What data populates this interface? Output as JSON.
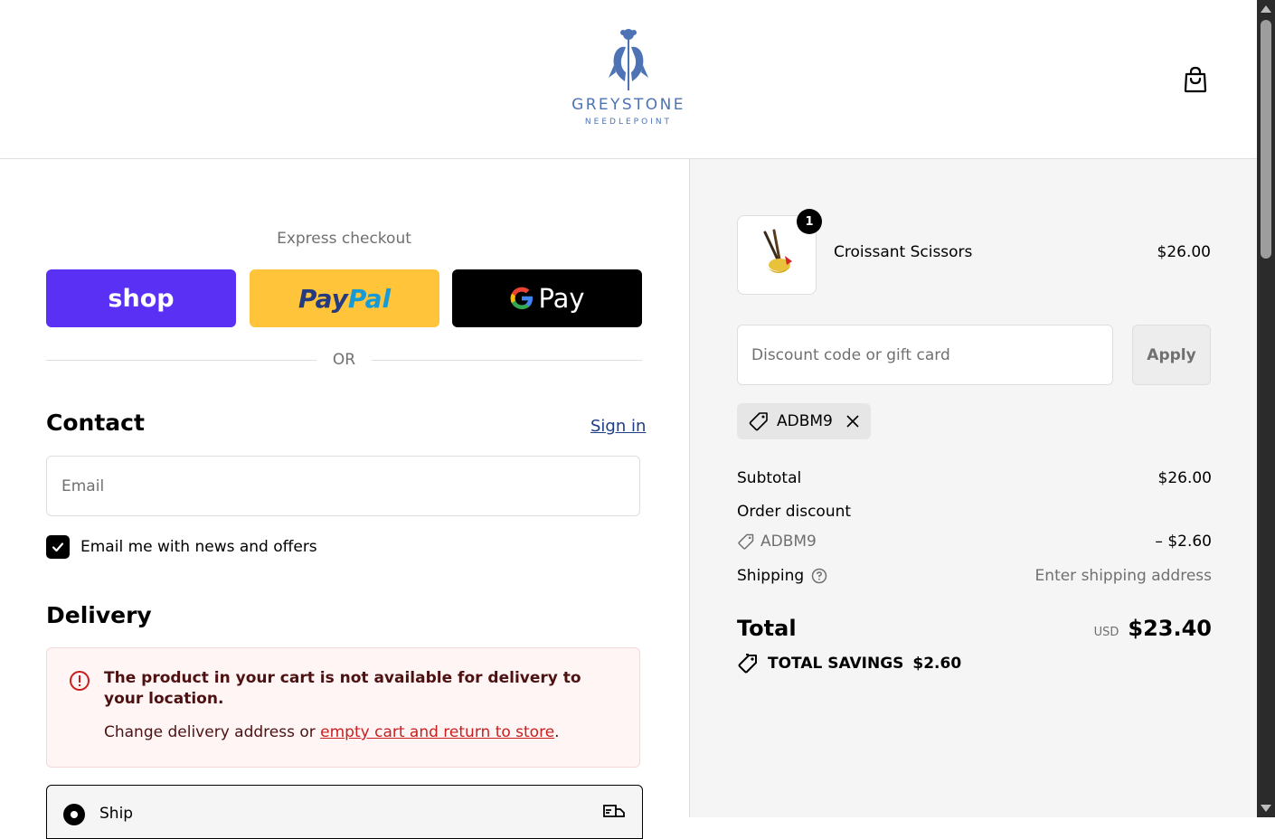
{
  "header": {
    "brand": "GREYSTONE",
    "brand_sub": "NEEDLEPOINT"
  },
  "express": {
    "title": "Express checkout",
    "shop_label": "shop",
    "paypal_part1": "Pay",
    "paypal_part2": "Pal",
    "gpay_g": "G",
    "gpay_label": "Pay",
    "or_label": "OR"
  },
  "contact": {
    "title": "Contact",
    "sign_in": "Sign in",
    "email_placeholder": "Email",
    "newsletter_label": "Email me with news and offers",
    "newsletter_checked": true
  },
  "delivery": {
    "title": "Delivery",
    "alert_title": "The product in your cart is not available for delivery to your location.",
    "alert_prefix": "Change delivery address or ",
    "alert_link": "empty cart and return to store",
    "alert_suffix": ".",
    "ship_label": "Ship"
  },
  "summary": {
    "product": {
      "name": "Croissant Scissors",
      "price": "$26.00",
      "quantity": "1"
    },
    "discount_placeholder": "Discount code or gift card",
    "apply_label": "Apply",
    "applied_code": "ADBM9",
    "subtotal_label": "Subtotal",
    "subtotal_value": "$26.00",
    "order_discount_label": "Order discount",
    "discount_code": "ADBM9",
    "discount_value": "– $2.60",
    "shipping_label": "Shipping",
    "shipping_value": "Enter shipping address",
    "total_label": "Total",
    "currency": "USD",
    "total_value": "$23.40",
    "savings_label": "TOTAL SAVINGS",
    "savings_value": "$2.60"
  },
  "colors": {
    "shop": "#5a31f4",
    "paypal": "#ffc439",
    "gpay": "#000000",
    "brand": "#4d73b5",
    "alert_bg": "#fff5f5",
    "link_error": "#c81e1e"
  }
}
